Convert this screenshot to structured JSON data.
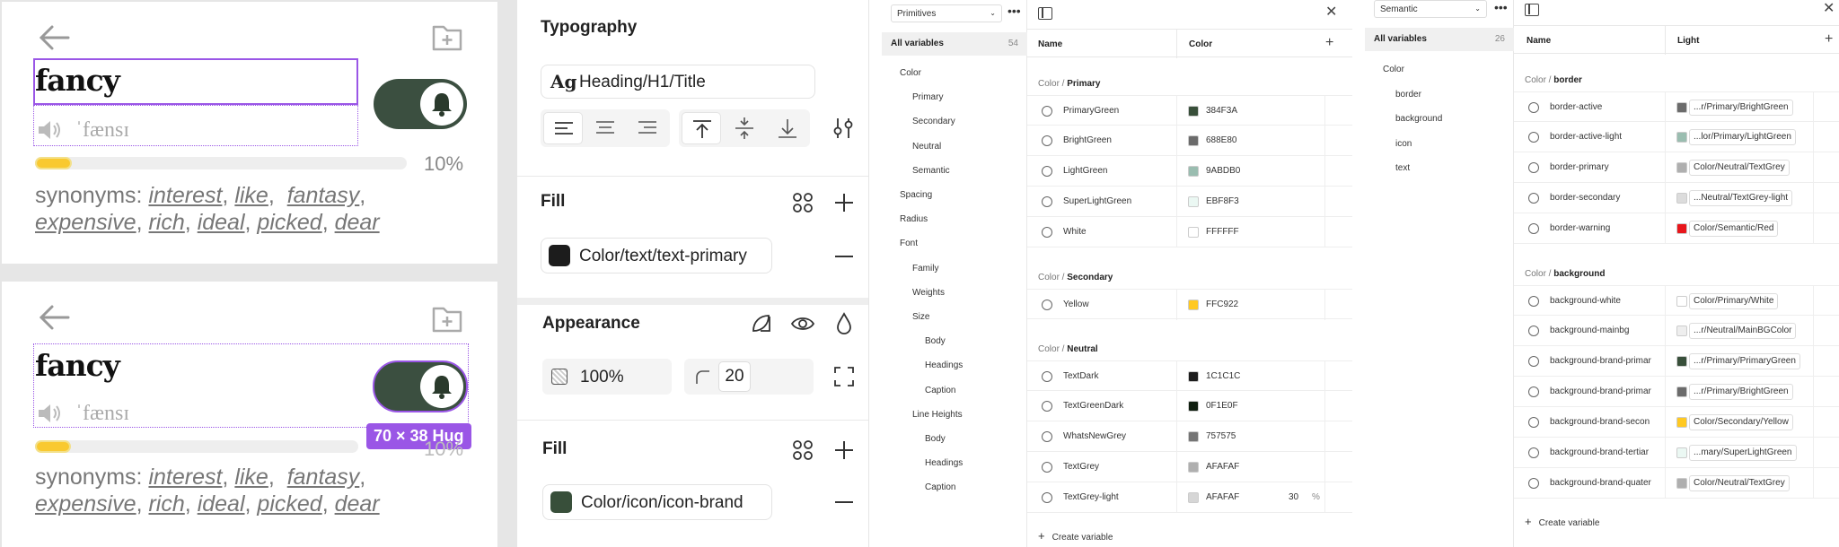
{
  "canvas": {
    "cards": [
      {
        "word": "fancy",
        "phonetic": "ˈfænsɪ",
        "percent": "10%",
        "progress": 0.1,
        "synonyms_label": "synonyms:",
        "synonyms": [
          "interest",
          "like",
          "fantasy",
          "expensive",
          "rich",
          "ideal",
          "picked",
          "dear"
        ]
      },
      {
        "word": "fancy",
        "phonetic": "ˈfænsɪ",
        "percent": "10%",
        "progress": 0.1,
        "synonyms_label": "synonyms:",
        "synonyms": [
          "interest",
          "like",
          "fantasy",
          "expensive",
          "rich",
          "ideal",
          "picked",
          "dear"
        ],
        "size_badge": "70 × 38 Hug"
      }
    ]
  },
  "props": {
    "typography_title": "Typography",
    "text_style": "Heading/H1/Title",
    "text_style_icon": "Ag",
    "fill_title": "Fill",
    "fill_top_color_name": "Color/text/text-primary",
    "fill_top_color": "#1c1c1c",
    "appearance_title": "Appearance",
    "opacity": "100%",
    "radius": "20",
    "fill_bottom_title": "Fill",
    "fill_bottom_color_name": "Color/icon/icon-brand",
    "fill_bottom_color": "#384F3A"
  },
  "primitives": {
    "collection": "Primitives",
    "all_variables": "All variables",
    "count": "54",
    "groups": [
      {
        "label": "Color",
        "indent": 0
      },
      {
        "label": "Primary",
        "indent": 1
      },
      {
        "label": "Secondary",
        "indent": 1
      },
      {
        "label": "Neutral",
        "indent": 1
      },
      {
        "label": "Semantic",
        "indent": 1
      },
      {
        "label": "Spacing",
        "indent": 0
      },
      {
        "label": "Radius",
        "indent": 0
      },
      {
        "label": "Font",
        "indent": 0
      },
      {
        "label": "Family",
        "indent": 1
      },
      {
        "label": "Weights",
        "indent": 1
      },
      {
        "label": "Size",
        "indent": 1
      },
      {
        "label": "Body",
        "indent": 2
      },
      {
        "label": "Headings",
        "indent": 2
      },
      {
        "label": "Caption",
        "indent": 2
      },
      {
        "label": "Line Heights",
        "indent": 1
      },
      {
        "label": "Body",
        "indent": 2
      },
      {
        "label": "Headings",
        "indent": 2
      },
      {
        "label": "Caption",
        "indent": 2
      }
    ],
    "col_name": "Name",
    "col_value": "Color",
    "sections": [
      {
        "prefix": "Color / ",
        "name": "Primary",
        "rows": [
          {
            "name": "PrimaryGreen",
            "value": "384F3A",
            "color": "#384F3A"
          },
          {
            "name": "BrightGreen",
            "value": "688E80",
            "color": "#6b6b6b"
          },
          {
            "name": "LightGreen",
            "value": "9ABDB0",
            "color": "#9ABDB0"
          },
          {
            "name": "SuperLightGreen",
            "value": "EBF8F3",
            "color": "#EBF8F3"
          },
          {
            "name": "White",
            "value": "FFFFFF",
            "color": "#FFFFFF"
          }
        ]
      },
      {
        "prefix": "Color / ",
        "name": "Secondary",
        "rows": [
          {
            "name": "Yellow",
            "value": "FFC922",
            "color": "#FFC922"
          }
        ]
      },
      {
        "prefix": "Color / ",
        "name": "Neutral",
        "rows": [
          {
            "name": "TextDark",
            "value": "1C1C1C",
            "color": "#1C1C1C"
          },
          {
            "name": "TextGreenDark",
            "value": "0F1E0F",
            "color": "#0F1E0F"
          },
          {
            "name": "WhatsNewGrey",
            "value": "757575",
            "color": "#757575"
          },
          {
            "name": "TextGrey",
            "value": "AFAFAF",
            "color": "#AFAFAF"
          },
          {
            "name": "TextGrey-light",
            "value": "AFAFAF",
            "color": "#d6d6d6",
            "opacity": "30",
            "opacity_unit": "%"
          }
        ]
      }
    ],
    "create_label": "Create variable"
  },
  "semantic": {
    "collection": "Semantic",
    "all_variables": "All variables",
    "count": "26",
    "groups": [
      {
        "label": "Color",
        "indent": 0
      },
      {
        "label": "border",
        "indent": 1
      },
      {
        "label": "background",
        "indent": 1
      },
      {
        "label": "icon",
        "indent": 1
      },
      {
        "label": "text",
        "indent": 1
      }
    ],
    "col_name": "Name",
    "col_value": "Light",
    "sections": [
      {
        "prefix": "Color / ",
        "name": "border",
        "rows": [
          {
            "name": "border-active",
            "value": "...r/Primary/BrightGreen",
            "color": "#6b6b6b"
          },
          {
            "name": "border-active-light",
            "value": "...lor/Primary/LightGreen",
            "color": "#9ABDB0"
          },
          {
            "name": "border-primary",
            "value": "Color/Neutral/TextGrey",
            "color": "#AFAFAF"
          },
          {
            "name": "border-secondary",
            "value": "...Neutral/TextGrey-light",
            "color": "#dcdcdc"
          },
          {
            "name": "border-warning",
            "value": "Color/Semantic/Red",
            "color": "#E8161B"
          }
        ]
      },
      {
        "prefix": "Color / ",
        "name": "background",
        "rows": [
          {
            "name": "background-white",
            "value": "Color/Primary/White",
            "color": "#FFFFFF"
          },
          {
            "name": "background-mainbg",
            "value": "...r/Neutral/MainBGColor",
            "color": "#EEEEEE"
          },
          {
            "name": "background-brand-primar",
            "value": "...r/Primary/PrimaryGreen",
            "color": "#384F3A"
          },
          {
            "name": "background-brand-primar",
            "value": "...r/Primary/BrightGreen",
            "color": "#6b6b6b"
          },
          {
            "name": "background-brand-secon",
            "value": "Color/Secondary/Yellow",
            "color": "#FFC922"
          },
          {
            "name": "background-brand-tertiar",
            "value": "...mary/SuperLightGreen",
            "color": "#EBF8F3"
          },
          {
            "name": "background-brand-quater",
            "value": "Color/Neutral/TextGrey",
            "color": "#AFAFAF"
          }
        ]
      }
    ],
    "create_label": "Create variable"
  }
}
